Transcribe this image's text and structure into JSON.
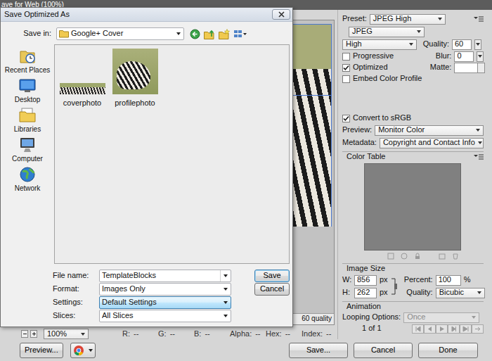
{
  "window": {
    "title": "ave for Web (100%)"
  },
  "dialog": {
    "title": "Save Optimized As",
    "save_in": {
      "label": "Save in:",
      "value": "Google+ Cover"
    },
    "places": [
      {
        "label": "Recent Places",
        "kind": "recent"
      },
      {
        "label": "Desktop",
        "kind": "desktop"
      },
      {
        "label": "Libraries",
        "kind": "libraries"
      },
      {
        "label": "Computer",
        "kind": "computer"
      },
      {
        "label": "Network",
        "kind": "network"
      }
    ],
    "files": [
      {
        "name": "coverphoto",
        "kind": "wide"
      },
      {
        "name": "profilephoto",
        "kind": "square"
      }
    ],
    "fields": [
      {
        "label": "File name:",
        "value": "TemplateBlocks",
        "kind": "combo",
        "hovered": false
      },
      {
        "label": "Format:",
        "value": "Images Only",
        "kind": "select",
        "hovered": false
      },
      {
        "label": "Settings:",
        "value": "Default Settings",
        "kind": "select",
        "hovered": true
      },
      {
        "label": "Slices:",
        "value": "All Slices",
        "kind": "select",
        "hovered": false
      }
    ],
    "buttons": [
      {
        "label": "Save",
        "default": true
      },
      {
        "label": "Cancel",
        "default": false
      }
    ]
  },
  "preview": {
    "caption": "60 quality"
  },
  "settings": {
    "preset": {
      "label": "Preset:",
      "value": "JPEG High"
    },
    "format": {
      "value": "JPEG"
    },
    "compression": {
      "value": "High"
    },
    "quality": {
      "label": "Quality:",
      "value": "60"
    },
    "blur": {
      "label": "Blur:",
      "value": "0"
    },
    "matte": {
      "label": "Matte:"
    },
    "options": [
      {
        "label": "Progressive",
        "checked": false
      },
      {
        "label": "Optimized",
        "checked": true
      },
      {
        "label": "Embed Color Profile",
        "checked": false
      }
    ],
    "convert": {
      "label": "Convert to sRGB",
      "checked": true
    },
    "preview_mode": {
      "label": "Preview:",
      "value": "Monitor Color"
    },
    "metadata": {
      "label": "Metadata:",
      "value": "Copyright and Contact Info"
    }
  },
  "color_table": {
    "title": "Color Table"
  },
  "image_size": {
    "title": "Image Size",
    "width": {
      "label": "W:",
      "value": "856",
      "unit": "px"
    },
    "height": {
      "label": "H:",
      "value": "262",
      "unit": "px"
    },
    "percent": {
      "label": "Percent:",
      "value": "100",
      "unit": "%"
    },
    "quality": {
      "label": "Quality:",
      "value": "Bicubic"
    }
  },
  "animation": {
    "title": "Animation",
    "looping": {
      "label": "Looping Options:",
      "value": "Once",
      "disabled": true
    },
    "frame": "1 of 1"
  },
  "status_bar": {
    "zoom": "100%",
    "readouts": [
      {
        "label": "R:",
        "value": "--"
      },
      {
        "label": "G:",
        "value": "--"
      },
      {
        "label": "B:",
        "value": "--"
      },
      {
        "label": "Alpha:",
        "value": "--"
      },
      {
        "label": "Hex:",
        "value": "--"
      },
      {
        "label": "Index:",
        "value": "--"
      }
    ]
  },
  "buttons": [
    "Preview...",
    "Save...",
    "Cancel",
    "Done"
  ]
}
